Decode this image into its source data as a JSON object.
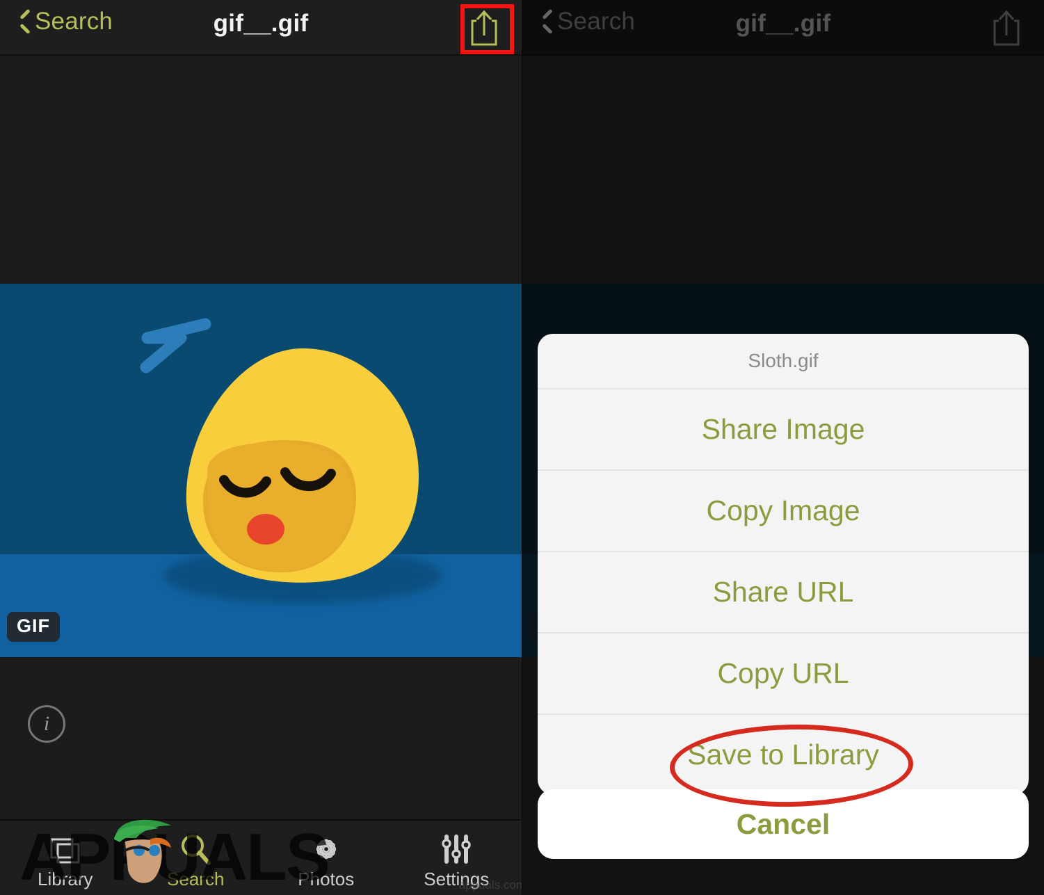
{
  "panels": {
    "left": {
      "nav": {
        "back_label": "Search",
        "title": "gif__.gif",
        "share_icon": "share-up-arrow-icon"
      },
      "gif": {
        "badge": "GIF",
        "info_icon": "info-circle-icon",
        "alt": "sleeping yellow blob emoji with zzz"
      },
      "annotation": {
        "type": "red-box",
        "target": "share-button"
      }
    },
    "right": {
      "nav": {
        "back_label": "Search",
        "title": "gif__.gif",
        "share_icon": "share-up-arrow-icon"
      },
      "sheet": {
        "title": "Sloth.gif",
        "items": [
          {
            "label": "Share Image"
          },
          {
            "label": "Copy Image"
          },
          {
            "label": "Share URL"
          },
          {
            "label": "Copy URL"
          },
          {
            "label": "Save to Library",
            "highlighted": true
          }
        ],
        "cancel_label": "Cancel"
      },
      "annotation": {
        "type": "red-ellipse",
        "target": "Save to Library"
      }
    }
  },
  "tabbar": {
    "items": [
      {
        "label": "Library",
        "icon": "photo-stack-icon",
        "active": false
      },
      {
        "label": "Search",
        "icon": "magnifier-icon",
        "active": true
      },
      {
        "label": "Photos",
        "icon": "flower-rosette-icon",
        "active": false
      },
      {
        "label": "Settings",
        "icon": "sliders-icon",
        "active": false
      }
    ]
  },
  "watermark": {
    "text": "APPUALS",
    "url": "appuals.com"
  },
  "colors": {
    "accent": "#b7bd59",
    "sheet_text": "#8d9b3e",
    "annotation_red": "#d52b1e",
    "nav_bg": "#1e1e1e",
    "gif_bg": "#0a4970",
    "gif_floor": "#1161a0",
    "blob": "#f7c52e"
  }
}
